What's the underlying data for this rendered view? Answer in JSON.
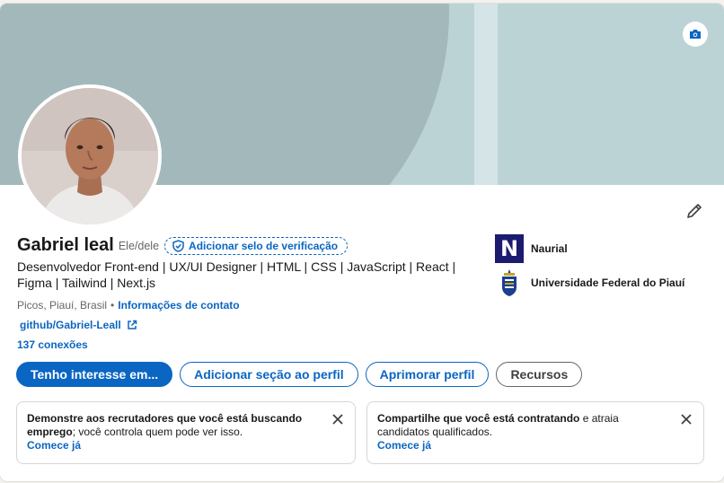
{
  "profile": {
    "name": "Gabriel leal",
    "pronouns": "Ele/dele",
    "verify_label": "Adicionar selo de verificação",
    "headline": "Desenvolvedor Front-end | UX/UI Designer | HTML | CSS | JavaScript | React | Figma | Tailwind | Next.js",
    "location": "Picos, Piauí, Brasil",
    "separator": "•",
    "contact_label": "Informações de contato",
    "website": "github/Gabriel-Leall",
    "connections": "137 conexões"
  },
  "actions": {
    "open_to": "Tenho interesse em...",
    "add_section": "Adicionar seção ao perfil",
    "enhance": "Aprimorar perfil",
    "resources": "Recursos"
  },
  "organizations": [
    {
      "name": "Naurial",
      "logo_letter": "N",
      "icon": "company-logo"
    },
    {
      "name": "Universidade Federal do Piauí",
      "icon": "university-logo"
    }
  ],
  "tips": [
    {
      "bold": "Demonstre aos recrutadores que você está buscando emprego",
      "rest": "; você controla quem pode ver isso.",
      "cta": "Comece já"
    },
    {
      "bold": "Compartilhe que você está contratando",
      "rest": " e atraia candidatos qualificados.",
      "cta": "Comece já"
    }
  ],
  "icons": {
    "camera": "camera-icon",
    "edit": "pencil-icon",
    "verify": "shield-check-icon",
    "external": "external-link-icon",
    "close": "close-icon"
  },
  "colors": {
    "accent": "#0a66c2",
    "banner": "#bcd3d6",
    "banner_shape": "#a3b8bb",
    "naurial": "#1b1b6f"
  }
}
